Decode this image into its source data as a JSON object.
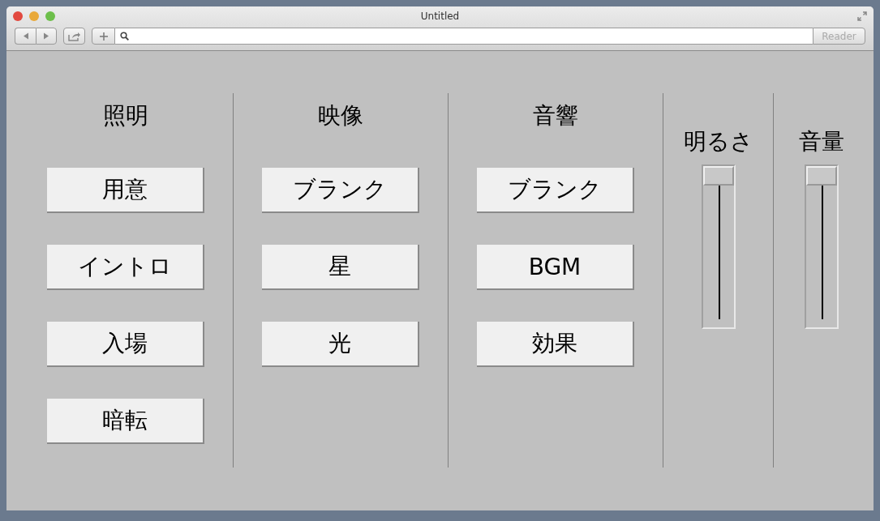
{
  "window": {
    "title": "Untitled"
  },
  "toolbar": {
    "reader_button": "Reader"
  },
  "sections": [
    {
      "kind": "buttons",
      "title": "照明",
      "buttons": [
        "用意",
        "イントロ",
        "入場",
        "暗転"
      ]
    },
    {
      "kind": "buttons",
      "title": "映像",
      "buttons": [
        "ブランク",
        "星",
        "光"
      ]
    },
    {
      "kind": "buttons",
      "title": "音響",
      "buttons": [
        "ブランク",
        "BGM",
        "効果"
      ]
    },
    {
      "kind": "slider",
      "title": "明るさ",
      "level": 1
    },
    {
      "kind": "slider",
      "title": "音量",
      "level": 1
    }
  ]
}
